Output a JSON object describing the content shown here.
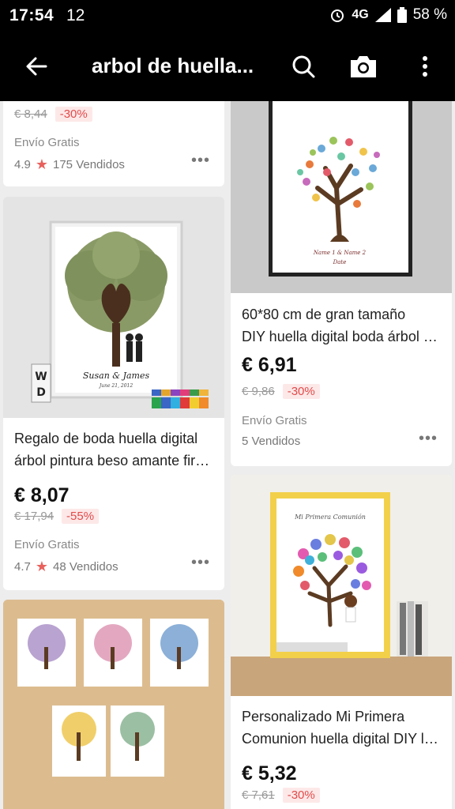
{
  "status": {
    "time": "17:54",
    "notif": "12",
    "network": "4G",
    "battery": "58 %"
  },
  "appbar": {
    "query": "arbol de huella..."
  },
  "products": [
    {
      "old_price": "€ 8,44",
      "discount": "-30%",
      "shipping": "Envío Gratis",
      "rating": "4.9",
      "sold": "175 Vendidos"
    },
    {
      "title_line1": "60*80 cm de gran tamaño",
      "title_line2": "DIY huella digital boda árbol pintura",
      "price": "€ 6,91",
      "old_price": "€ 9,86",
      "discount": "-30%",
      "shipping": "Envío Gratis",
      "sold": "5 Vendidos",
      "frame_text1": "Name 1 & Name 2",
      "frame_text2": "Date"
    },
    {
      "title_line1": "Regalo de boda huella digital",
      "title_line2": "árbol pintura beso amante firma",
      "price": "€ 8,07",
      "old_price": "€ 17,94",
      "discount": "-55%",
      "shipping": "Envío Gratis",
      "rating": "4.7",
      "sold": "48 Vendidos",
      "frame_text1": "Susan & James",
      "frame_text2": "June 21, 2012"
    },
    {
      "title_line1": "Personalizado Mi Primera",
      "title_line2": "Comunion huella digital DIY lienzo",
      "price": "€ 5,32",
      "old_price": "€ 7,61",
      "discount": "-30%",
      "frame_text1": "Mi Primera Comunión"
    },
    {}
  ],
  "colors": {
    "accent_red": "#e24b4b",
    "star": "#e8615c",
    "bar": "#000000"
  }
}
